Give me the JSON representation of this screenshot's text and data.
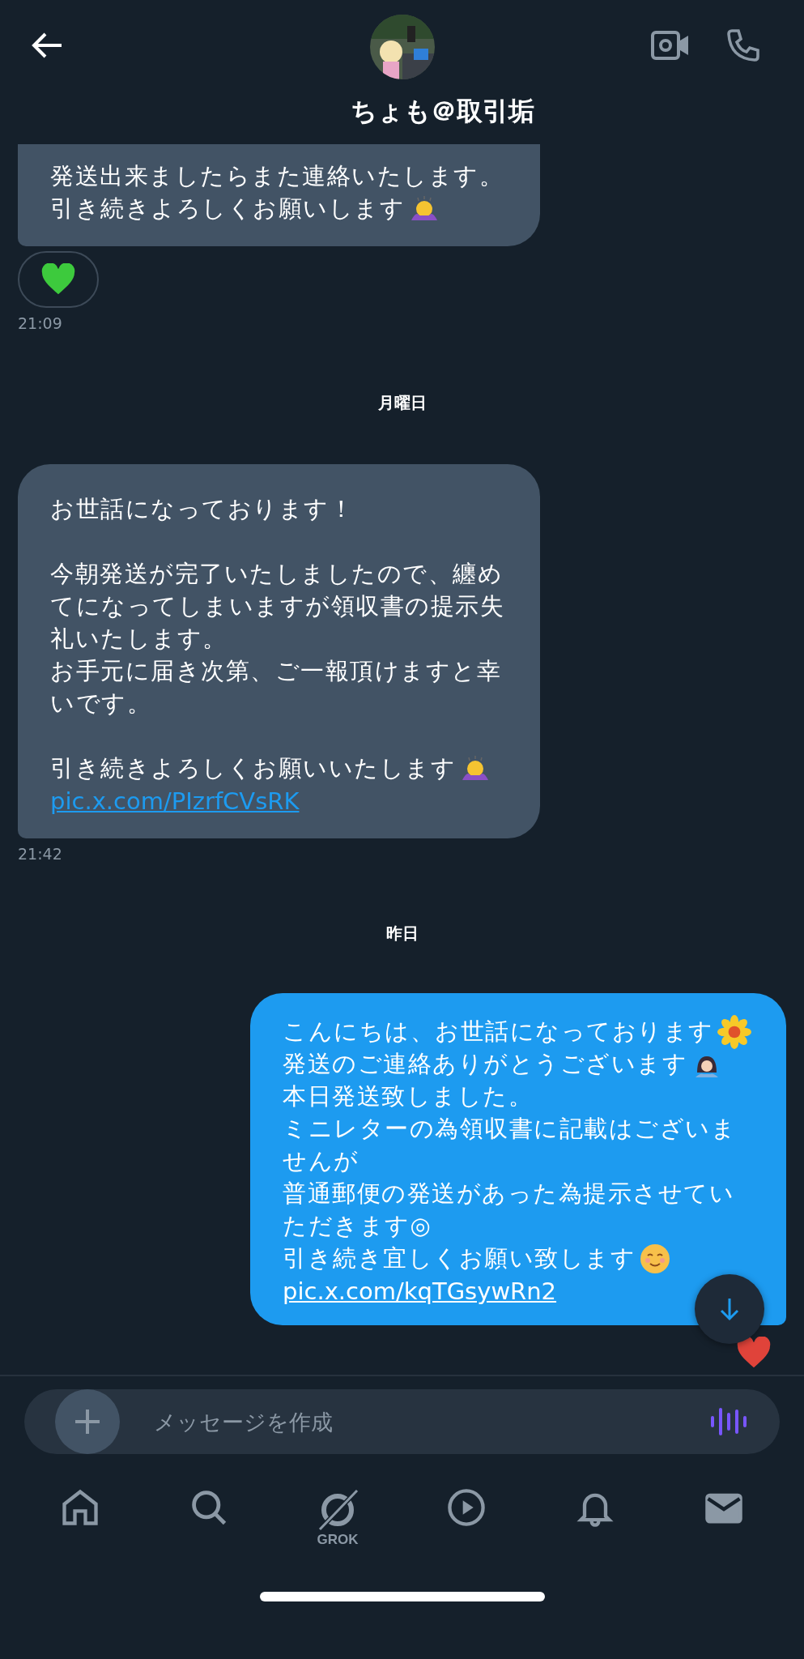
{
  "header": {
    "name": "ちょも＠取引垢"
  },
  "thread": [
    {
      "kind": "received",
      "cut": true,
      "lines": [
        {
          "text": "発送出来ましたらまた連絡いたします。"
        },
        {
          "text": "引き続きよろしくお願いします",
          "emoji": {
            "kind": "bow"
          }
        }
      ],
      "reaction": {
        "color": "#3dca3d"
      }
    },
    {
      "kind": "time",
      "text": "21:09"
    },
    {
      "kind": "date",
      "text": "月曜日"
    },
    {
      "kind": "received",
      "cut": false,
      "lines": [
        {
          "text": "お世話になっております！"
        },
        {
          "kind": "blank"
        },
        {
          "text": "今朝発送が完了いたしましたので、纏め"
        },
        {
          "text": "てになってしまいますが領収書の提示失"
        },
        {
          "text": "礼いたします。"
        },
        {
          "text": "お手元に届き次第、ご一報頂けますと幸"
        },
        {
          "text": "いです。"
        },
        {
          "kind": "blank"
        },
        {
          "text": "引き続きよろしくお願いいたします",
          "emoji": {
            "kind": "bow"
          }
        },
        {
          "text": "pic.x.com/PIzrfCVsRK",
          "kind": "link"
        }
      ]
    },
    {
      "kind": "time",
      "text": "21:42"
    },
    {
      "kind": "date",
      "text": "昨日"
    },
    {
      "kind": "sent",
      "cut": false,
      "lines": [
        {
          "text": "こんにちは、お世話になっております",
          "emoji": {
            "kind": "flower"
          }
        },
        {
          "text": "発送のご連絡ありがとうございます",
          "emoji": {
            "kind": "woman"
          }
        },
        {
          "text": "本日発送致しました。"
        },
        {
          "text": "ミニレターの為領収書に記載はございま"
        },
        {
          "text": "せんが"
        },
        {
          "text": "普通郵便の発送があった為提示させてい"
        },
        {
          "text": "ただきます◎"
        },
        {
          "text": "引き続き宜しくお願い致します",
          "emoji": {
            "kind": "smile"
          }
        },
        {
          "text": "pic.x.com/kqTGsywRn2",
          "kind": "link"
        }
      ],
      "reaction": {
        "color": "#e0433a"
      }
    }
  ],
  "composer": {
    "placeholder": "メッセージを作成"
  },
  "nav": [
    {
      "kind": "home",
      "selected": false
    },
    {
      "kind": "search",
      "selected": false
    },
    {
      "kind": "grok",
      "label": "GROK",
      "selected": false
    },
    {
      "kind": "video",
      "selected": false
    },
    {
      "kind": "bell",
      "selected": false
    },
    {
      "kind": "mail",
      "selected": true
    }
  ]
}
